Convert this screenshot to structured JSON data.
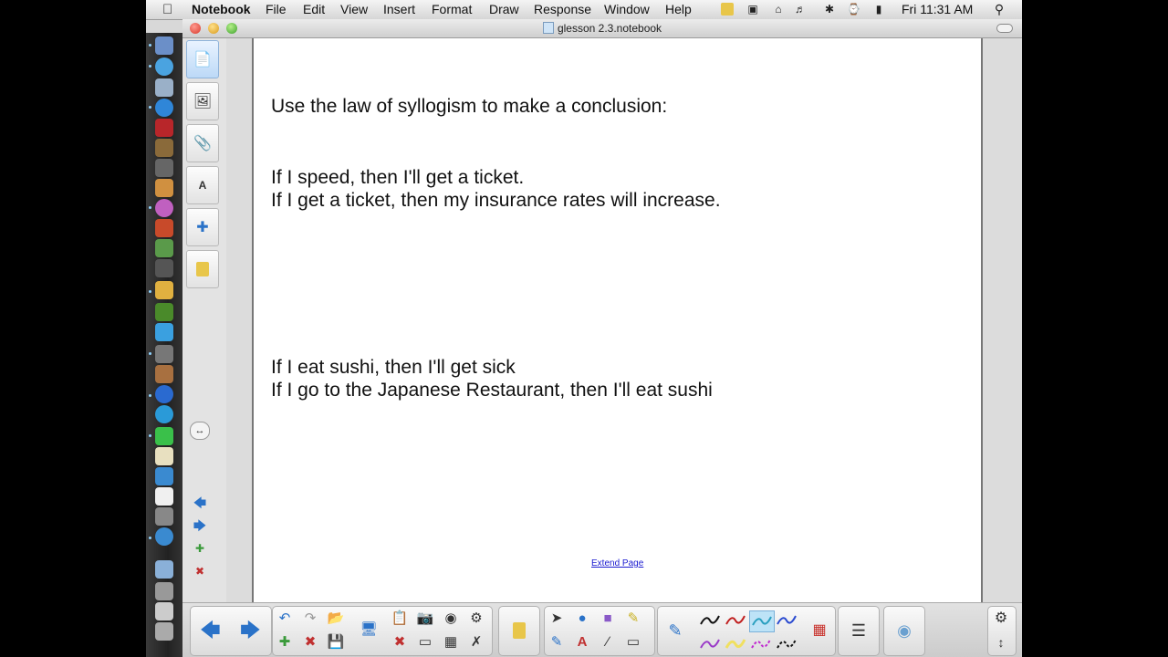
{
  "menubar": {
    "apple_icon": "apple-icon",
    "app_name": "Notebook",
    "items": [
      "File",
      "Edit",
      "View",
      "Insert",
      "Format",
      "Draw",
      "Response",
      "Window",
      "Help"
    ],
    "clock": "Fri 11:31 AM"
  },
  "window": {
    "title": "glesson 2.3.notebook"
  },
  "page": {
    "line1": "Use the law of syllogism to make a conclusion:",
    "line2": "If I speed, then I'll get a ticket.",
    "line3": "If I get a ticket, then my insurance rates will increase.",
    "line4": "If I eat sushi, then I'll get sick",
    "line5": "If I go to the Japanese Restaurant, then I'll eat sushi",
    "extend_link": "Extend Page"
  },
  "sidebar_tabs": [
    "page-sorter-icon",
    "gallery-icon",
    "attachments-icon",
    "properties-icon",
    "addons-icon",
    "response-icon"
  ],
  "colors": {
    "accent": "#2a72c8",
    "menubar_bg": "#e6e6e6",
    "page_bg": "#ffffff",
    "link": "#1b1bd0"
  }
}
